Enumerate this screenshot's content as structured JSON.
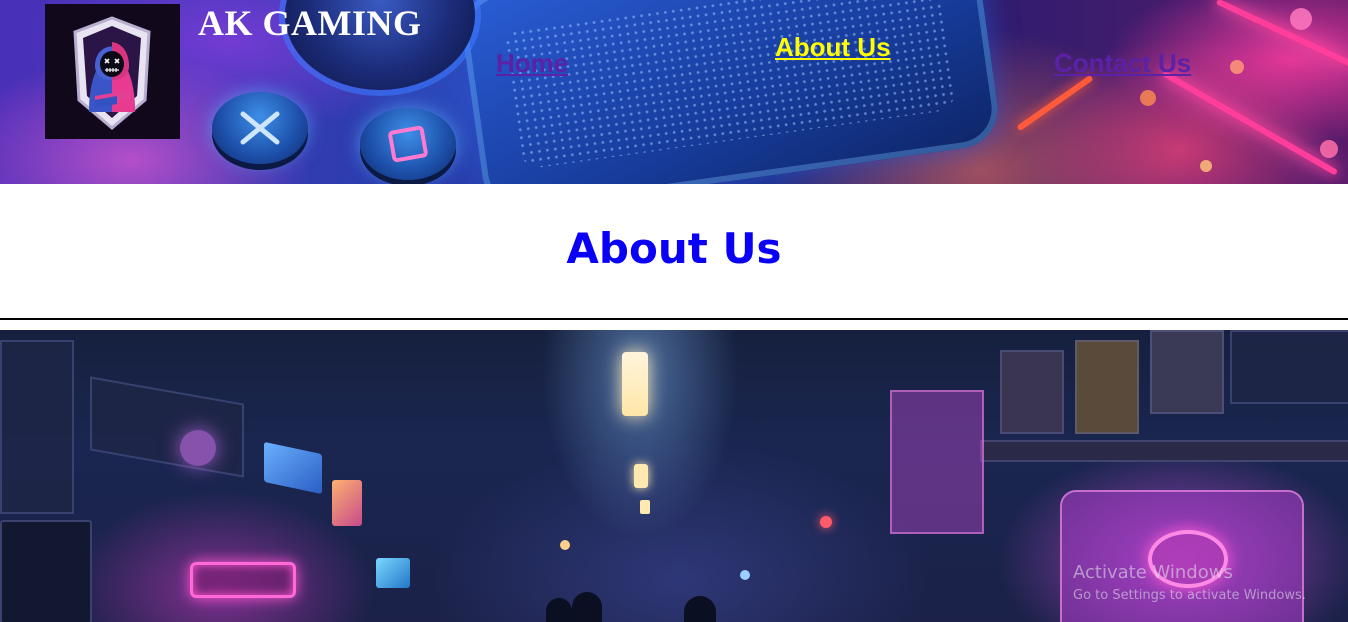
{
  "header": {
    "brand": "AK GAMING",
    "logo_icon": "hooded-gamer-logo-icon"
  },
  "nav": {
    "home": "Home",
    "about": "About Us",
    "contact": "Contact Us",
    "active_color": "#ffff00",
    "link_color": "#5b21a6"
  },
  "main": {
    "title": "About Us",
    "title_color": "#0a00f5"
  },
  "hero": {
    "image": "neon-gaming-room-image"
  },
  "watermark": {
    "title": "Activate Windows",
    "subtitle": "Go to Settings to activate Windows."
  }
}
